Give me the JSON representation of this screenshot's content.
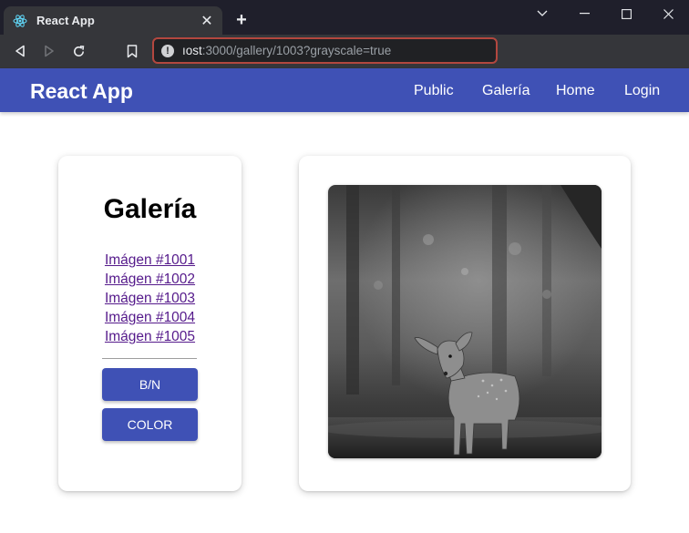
{
  "browser": {
    "tab_title": "React App",
    "close_glyph": "✕",
    "new_tab_glyph": "+",
    "url_host": "ıost",
    "url_rest": ":3000/gallery/1003?grayscale=true",
    "url_border_color": "#b3473f"
  },
  "app": {
    "brand": "React App",
    "nav": [
      "Public",
      "Galería",
      "Home",
      "Login"
    ],
    "primary_color": "#3f51b5"
  },
  "gallery": {
    "title": "Galería",
    "links": [
      "Imágen #1001",
      "Imágen #1002",
      "Imágen #1003",
      "Imágen #1004",
      "Imágen #1005"
    ],
    "bw_button": "B/N",
    "color_button": "COLOR",
    "image_subject": "deer",
    "grayscale": true
  }
}
